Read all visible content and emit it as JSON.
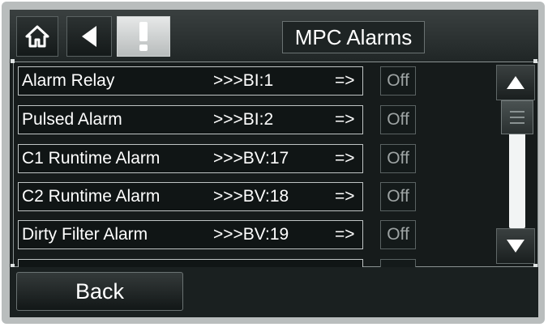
{
  "header": {
    "title": "MPC Alarms",
    "home_icon": "home-icon",
    "back_icon": "back-arrow-icon",
    "alarm_icon": "exclamation-icon"
  },
  "alarms": [
    {
      "name": "Alarm Relay",
      "ref": ">>>BI:1",
      "arrow": "=>",
      "value": "Off"
    },
    {
      "name": "Pulsed Alarm",
      "ref": ">>>BI:2",
      "arrow": "=>",
      "value": "Off"
    },
    {
      "name": "C1 Runtime Alarm",
      "ref": ">>>BV:17",
      "arrow": "=>",
      "value": "Off"
    },
    {
      "name": "C2 Runtime Alarm",
      "ref": ">>>BV:18",
      "arrow": "=>",
      "value": "Off"
    },
    {
      "name": "Dirty Filter Alarm",
      "ref": ">>>BV:19",
      "arrow": "=>",
      "value": "Off"
    }
  ],
  "scroll": {
    "up_icon": "scroll-up-icon",
    "down_icon": "scroll-down-icon"
  },
  "footer": {
    "back_label": "Back"
  }
}
